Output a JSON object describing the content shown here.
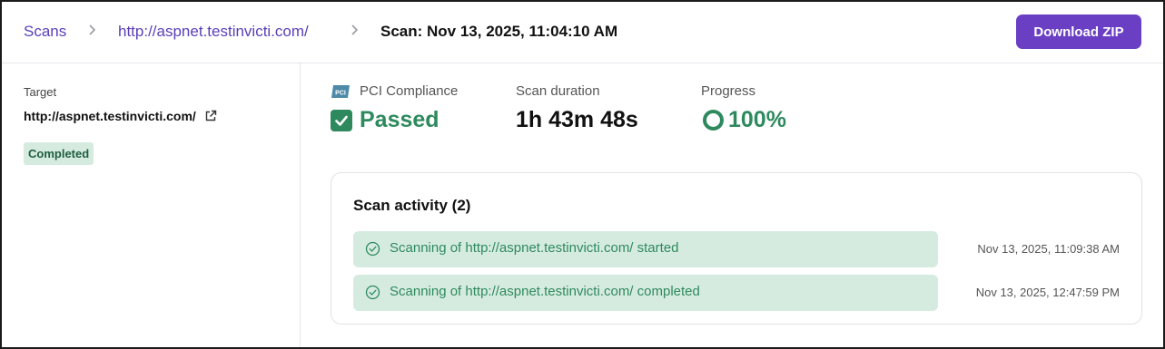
{
  "breadcrumb": {
    "scans_label": "Scans",
    "target_label": "http://aspnet.testinvicti.com/",
    "current_label": "Scan: Nov 13, 2025, 11:04:10 AM",
    "separator": ">"
  },
  "header": {
    "download_label": "Download ZIP"
  },
  "sidebar": {
    "target_label": "Target",
    "target_url": "http://aspnet.testinvicti.com/",
    "status": "Completed"
  },
  "stats": {
    "pci": {
      "label": "PCI Compliance",
      "value": "Passed",
      "logo_text": "PCI"
    },
    "duration": {
      "label": "Scan duration",
      "value": "1h 43m 48s"
    },
    "progress": {
      "label": "Progress",
      "value": "100%",
      "fraction": 1.0
    }
  },
  "activity": {
    "title": "Scan activity (2)",
    "items": [
      {
        "text": "Scanning of http://aspnet.testinvicti.com/ started",
        "time": "Nov 13, 2025, 11:09:38 AM"
      },
      {
        "text": "Scanning of http://aspnet.testinvicti.com/ completed",
        "time": "Nov 13, 2025, 12:47:59 PM"
      }
    ]
  },
  "colors": {
    "accent": "#6a3fc4",
    "link": "#5b3fb8",
    "success": "#2e8a5e",
    "success_bg": "#d6ebe0"
  },
  "icons": {
    "external_link": "external-link-icon",
    "check": "check-icon",
    "progress_ring": "progress-ring-icon",
    "check_circle": "check-circle-icon",
    "pci": "pci-logo-icon"
  }
}
